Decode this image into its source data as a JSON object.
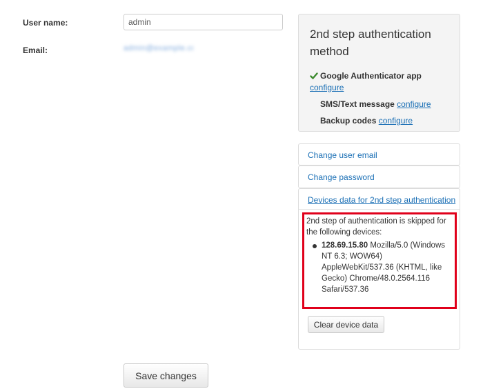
{
  "form": {
    "username_label": "User name:",
    "username_value": "admin",
    "email_label": "Email:",
    "email_value": "admin@example.com"
  },
  "two_step": {
    "title": "2nd step authentication method",
    "google_label": "Google Authenticator app",
    "google_link": "configure",
    "sms_label": "SMS/Text message",
    "sms_link": "configure",
    "backup_label": "Backup codes",
    "backup_link": "configure",
    "check_icon": "check-icon",
    "check_color": "#3c8a2e"
  },
  "links": {
    "change_email": "Change user email",
    "change_password": "Change password"
  },
  "devices": {
    "heading": "Devices data for 2nd step authentication",
    "intro": "2nd step of authentication is skipped for the following devices:",
    "items": [
      {
        "ip": "128.69.15.80",
        "agent": "Mozilla/5.0 (Windows NT 6.3; WOW64) AppleWebKit/537.36 (KHTML, like Gecko) Chrome/48.0.2564.116 Safari/537.36"
      }
    ],
    "clear_button": "Clear device data",
    "highlight_color": "#e0001b"
  },
  "actions": {
    "save_button": "Save changes"
  }
}
